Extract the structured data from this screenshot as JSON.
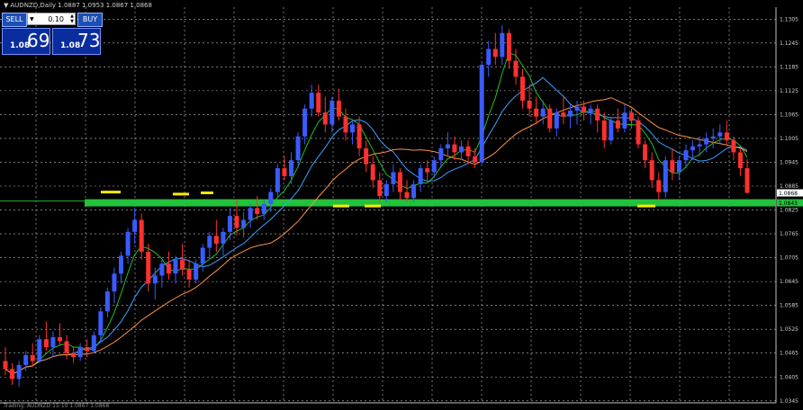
{
  "window": {
    "title": "AUDNZD,Daily  1.0887 1.0953 1.0867 1.0868",
    "status": "Trading: AUDNZD 15:10 1.0867 1.0868"
  },
  "trade_panel": {
    "sell_label": "SELL",
    "buy_label": "BUY",
    "lot_value": "0.10",
    "sell_small": "1.08",
    "sell_big": "69",
    "buy_small": "1.08",
    "buy_big": "73"
  },
  "colors": {
    "background": "#000000",
    "grid": "#c0c0c0",
    "bull_candle": "#3a5bff",
    "bear_candle": "#ff3030",
    "ma_fast": "#20c020",
    "ma_mid": "#3aa0ff",
    "ma_slow": "#ff9040",
    "support_line": "#22c23a",
    "highlight_marks": "#ffe800",
    "current_price_label": "#ffffff"
  },
  "chart_data": {
    "type": "candlestick",
    "symbol": "AUDNZD",
    "timeframe": "Daily",
    "ohlc_header": {
      "open": 1.0887,
      "high": 1.0953,
      "low": 1.0867,
      "close": 1.0868
    },
    "y_axis": {
      "ticks": [
        "1.1305",
        "1.1245",
        "1.1185",
        "1.1125",
        "1.1065",
        "1.1005",
        "1.0945",
        "1.0885",
        "1.0825",
        "1.0765",
        "1.0705",
        "1.0645",
        "1.0585",
        "1.0525",
        "1.0465",
        "1.0405",
        "1.0345"
      ],
      "range": [
        1.034,
        1.1335
      ]
    },
    "price_labels": {
      "current": "1.0868",
      "support": "1.0843"
    },
    "support_level": 1.0843,
    "candles": [
      [
        1.0445,
        1.048,
        1.041,
        1.0425
      ],
      [
        1.0425,
        1.044,
        1.0385,
        1.04
      ],
      [
        1.04,
        1.0445,
        1.038,
        1.0435
      ],
      [
        1.0435,
        1.047,
        1.042,
        1.046
      ],
      [
        1.046,
        1.049,
        1.043,
        1.0445
      ],
      [
        1.0445,
        1.051,
        1.044,
        1.05
      ],
      [
        1.05,
        1.0545,
        1.047,
        1.048
      ],
      [
        1.048,
        1.052,
        1.0455,
        1.0505
      ],
      [
        1.0505,
        1.054,
        1.0485,
        1.0495
      ],
      [
        1.0495,
        1.051,
        1.045,
        1.0465
      ],
      [
        1.0465,
        1.048,
        1.044,
        1.0455
      ],
      [
        1.0455,
        1.049,
        1.0445,
        1.048
      ],
      [
        1.048,
        1.05,
        1.0455,
        1.047
      ],
      [
        1.047,
        1.052,
        1.0465,
        1.051
      ],
      [
        1.051,
        1.058,
        1.0495,
        1.057
      ],
      [
        1.057,
        1.063,
        1.0555,
        1.062
      ],
      [
        1.062,
        1.068,
        1.059,
        1.0665
      ],
      [
        1.0665,
        1.072,
        1.064,
        1.071
      ],
      [
        1.071,
        1.078,
        1.069,
        1.077
      ],
      [
        1.077,
        1.083,
        1.074,
        1.08
      ],
      [
        1.08,
        1.0815,
        1.07,
        1.072
      ],
      [
        1.072,
        1.074,
        1.062,
        1.064
      ],
      [
        1.064,
        1.068,
        1.06,
        1.066
      ],
      [
        1.066,
        1.07,
        1.063,
        1.069
      ],
      [
        1.069,
        1.072,
        1.065,
        1.0665
      ],
      [
        1.0665,
        1.071,
        1.064,
        1.07
      ],
      [
        1.07,
        1.074,
        1.066,
        1.0675
      ],
      [
        1.0675,
        1.07,
        1.063,
        1.065
      ],
      [
        1.065,
        1.07,
        1.064,
        1.069
      ],
      [
        1.069,
        1.074,
        1.067,
        1.073
      ],
      [
        1.073,
        1.077,
        1.07,
        1.076
      ],
      [
        1.076,
        1.08,
        1.072,
        1.074
      ],
      [
        1.074,
        1.078,
        1.071,
        1.077
      ],
      [
        1.077,
        1.083,
        1.075,
        1.081
      ],
      [
        1.081,
        1.085,
        1.076,
        1.078
      ],
      [
        1.078,
        1.082,
        1.0755,
        1.08
      ],
      [
        1.08,
        1.084,
        1.078,
        1.083
      ],
      [
        1.083,
        1.086,
        1.08,
        1.0815
      ],
      [
        1.0815,
        1.085,
        1.08,
        1.084
      ],
      [
        1.084,
        1.088,
        1.082,
        1.087
      ],
      [
        1.087,
        1.094,
        1.0855,
        1.093
      ],
      [
        1.093,
        1.096,
        1.09,
        1.091
      ],
      [
        1.091,
        1.097,
        1.089,
        1.095
      ],
      [
        1.095,
        1.102,
        1.093,
        1.101
      ],
      [
        1.101,
        1.109,
        1.099,
        1.108
      ],
      [
        1.108,
        1.114,
        1.106,
        1.112
      ],
      [
        1.112,
        1.114,
        1.106,
        1.107
      ],
      [
        1.107,
        1.111,
        1.102,
        1.104
      ],
      [
        1.104,
        1.111,
        1.102,
        1.11
      ],
      [
        1.11,
        1.113,
        1.105,
        1.106
      ],
      [
        1.106,
        1.108,
        1.1,
        1.102
      ],
      [
        1.102,
        1.105,
        1.099,
        1.104
      ],
      [
        1.104,
        1.106,
        1.096,
        1.098
      ],
      [
        1.098,
        1.1,
        1.092,
        1.094
      ],
      [
        1.094,
        1.096,
        1.088,
        1.09
      ],
      [
        1.09,
        1.092,
        1.0845,
        1.086
      ],
      [
        1.086,
        1.09,
        1.0845,
        1.089
      ],
      [
        1.089,
        1.094,
        1.087,
        1.092
      ],
      [
        1.092,
        1.093,
        1.085,
        1.087
      ],
      [
        1.087,
        1.09,
        1.0845,
        1.0855
      ],
      [
        1.0855,
        1.09,
        1.0845,
        1.089
      ],
      [
        1.089,
        1.094,
        1.087,
        1.093
      ],
      [
        1.093,
        1.095,
        1.09,
        1.092
      ],
      [
        1.092,
        1.096,
        1.0905,
        1.095
      ],
      [
        1.095,
        1.099,
        1.093,
        1.098
      ],
      [
        1.098,
        1.102,
        1.096,
        1.099
      ],
      [
        1.099,
        1.101,
        1.095,
        1.097
      ],
      [
        1.097,
        1.1,
        1.095,
        1.0985
      ],
      [
        1.0985,
        1.1,
        1.094,
        1.096
      ],
      [
        1.096,
        1.098,
        1.093,
        1.0945
      ],
      [
        1.0945,
        1.12,
        1.094,
        1.119
      ],
      [
        1.119,
        1.125,
        1.116,
        1.123
      ],
      [
        1.123,
        1.127,
        1.119,
        1.121
      ],
      [
        1.121,
        1.129,
        1.119,
        1.127
      ],
      [
        1.127,
        1.128,
        1.118,
        1.12
      ],
      [
        1.12,
        1.123,
        1.114,
        1.116
      ],
      [
        1.116,
        1.118,
        1.108,
        1.11
      ],
      [
        1.11,
        1.114,
        1.106,
        1.108
      ],
      [
        1.108,
        1.111,
        1.104,
        1.106
      ],
      [
        1.106,
        1.11,
        1.104,
        1.108
      ],
      [
        1.108,
        1.109,
        1.102,
        1.103
      ],
      [
        1.103,
        1.108,
        1.101,
        1.107
      ],
      [
        1.107,
        1.111,
        1.104,
        1.106
      ],
      [
        1.106,
        1.109,
        1.103,
        1.1075
      ],
      [
        1.1075,
        1.11,
        1.104,
        1.1085
      ],
      [
        1.1085,
        1.11,
        1.105,
        1.107
      ],
      [
        1.107,
        1.109,
        1.104,
        1.108
      ],
      [
        1.108,
        1.109,
        1.102,
        1.105
      ],
      [
        1.105,
        1.107,
        1.098,
        1.1
      ],
      [
        1.1,
        1.106,
        1.099,
        1.105
      ],
      [
        1.105,
        1.108,
        1.102,
        1.103
      ],
      [
        1.103,
        1.109,
        1.102,
        1.107
      ],
      [
        1.107,
        1.108,
        1.103,
        1.105
      ],
      [
        1.105,
        1.106,
        1.098,
        1.099
      ],
      [
        1.099,
        1.1,
        1.093,
        1.095
      ],
      [
        1.095,
        1.097,
        1.088,
        1.09
      ],
      [
        1.09,
        1.092,
        1.085,
        1.087
      ],
      [
        1.087,
        1.096,
        1.0855,
        1.095
      ],
      [
        1.095,
        1.098,
        1.09,
        1.092
      ],
      [
        1.092,
        1.096,
        1.09,
        1.095
      ],
      [
        1.095,
        1.099,
        1.093,
        1.0975
      ],
      [
        1.0975,
        1.1,
        1.095,
        1.0985
      ],
      [
        1.0985,
        1.101,
        1.096,
        1.099
      ],
      [
        1.099,
        1.102,
        1.097,
        1.1005
      ],
      [
        1.1005,
        1.103,
        1.098,
        1.101
      ],
      [
        1.101,
        1.104,
        1.099,
        1.102
      ],
      [
        1.102,
        1.105,
        1.099,
        1.1
      ],
      [
        1.1,
        1.101,
        1.095,
        1.097
      ],
      [
        1.097,
        1.098,
        1.091,
        1.093
      ],
      [
        1.093,
        1.0953,
        1.0867,
        1.0868
      ]
    ],
    "moving_averages": [
      {
        "color": "#20c020",
        "period": 5
      },
      {
        "color": "#3aa0ff",
        "period": 10
      },
      {
        "color": "#ff9040",
        "period": 20
      }
    ],
    "highlight_marks": [
      1.087,
      1.0865,
      1.0868,
      1.0835,
      1.0835,
      1.0835
    ]
  }
}
